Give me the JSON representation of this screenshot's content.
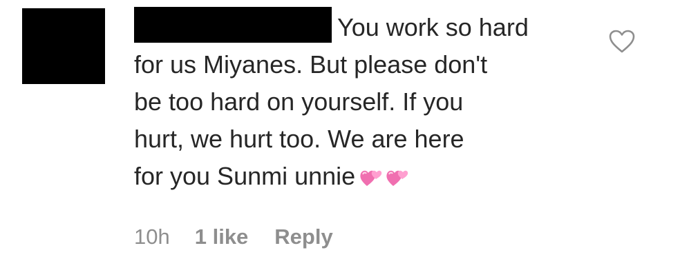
{
  "comment": {
    "avatar": "redacted-avatar",
    "username": "",
    "lines": [
      "You work so hard",
      "for us Miyanes. But please don't",
      "be too hard on yourself. If you",
      "hurt, we hurt too. We are here",
      "for you Sunmi unnie"
    ],
    "emoji": [
      "revolving-hearts-icon",
      "revolving-hearts-icon"
    ],
    "like_icon": "heart-outline-icon"
  },
  "meta": {
    "time": "10h",
    "likes": "1 like",
    "reply": "Reply"
  },
  "colors": {
    "text": "#262626",
    "secondary": "#8e8e8e",
    "redaction": "#000000",
    "heart_pink": "#f06fb0",
    "heart_light": "#ff9fd0"
  }
}
